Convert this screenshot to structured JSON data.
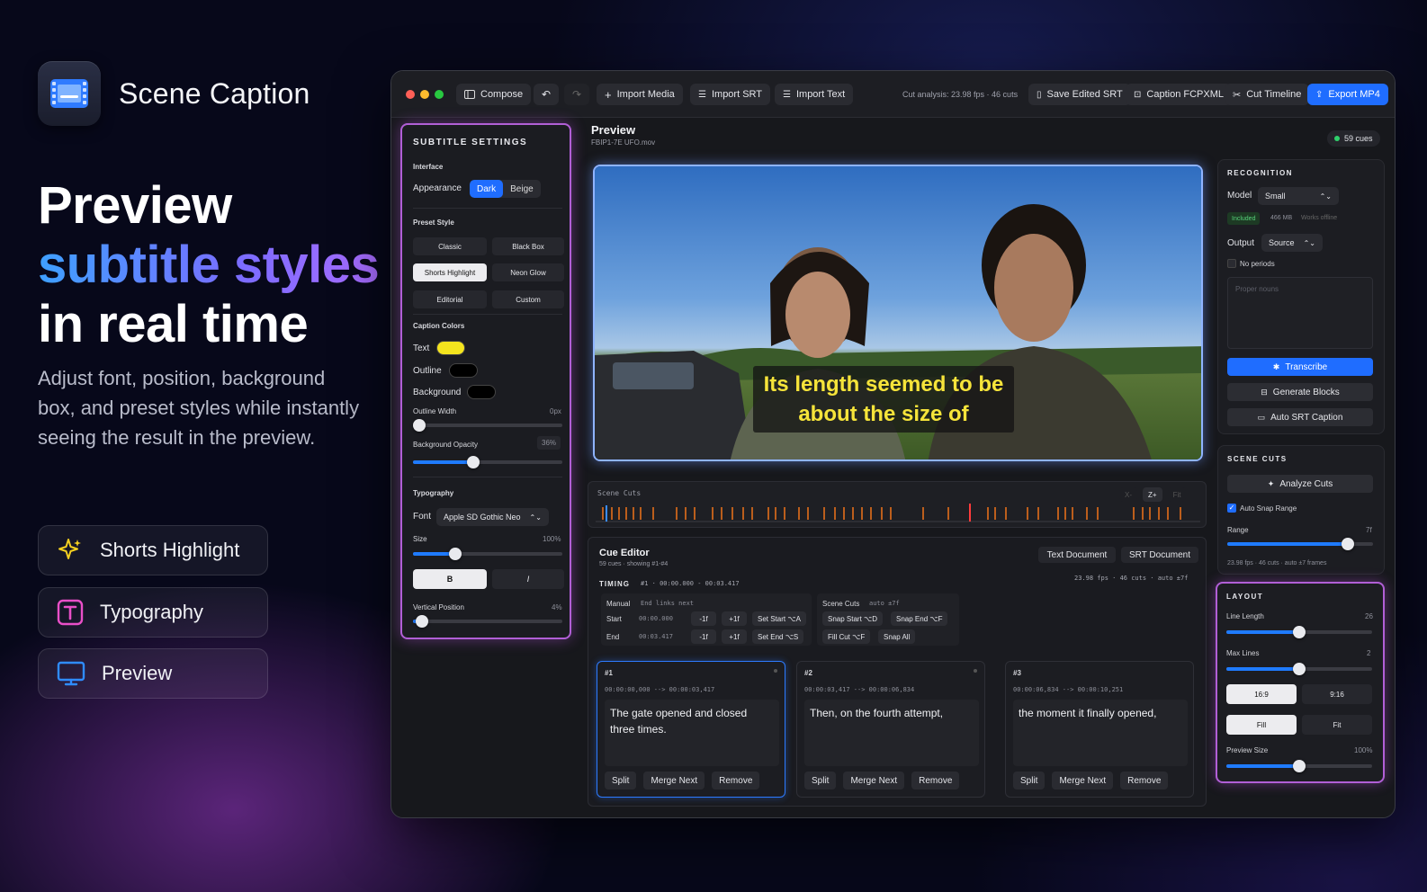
{
  "brand": {
    "name": "Scene Caption"
  },
  "headline": {
    "line1": "Preview",
    "line2": "subtitle styles",
    "line3": "in real time"
  },
  "subtitle": "Adjust font, position, background box, and preset styles while instantly seeing the result in the preview.",
  "features": [
    {
      "icon": "sparkle-icon",
      "label": "Shorts Highlight"
    },
    {
      "icon": "text-t-icon",
      "label": "Typography"
    },
    {
      "icon": "monitor-icon",
      "label": "Preview"
    }
  ],
  "toolbar": {
    "compose": "Compose",
    "import_media": "Import Media",
    "import_srt": "Import SRT",
    "import_text": "Import Text",
    "cut_analysis": "Cut analysis: 23.98 fps · 46 cuts",
    "save_srt": "Save Edited SRT",
    "caption_fcpxml": "Caption FCPXML",
    "cut_timeline": "Cut Timeline",
    "export_mp4": "Export MP4"
  },
  "settings": {
    "title": "SUBTITLE SETTINGS",
    "interface": "Interface",
    "appearance_label": "Appearance",
    "appearance_options": [
      "Dark",
      "Beige"
    ],
    "appearance_selected": "Dark",
    "preset_style": "Preset Style",
    "presets": [
      "Classic",
      "Black Box",
      "Shorts Highlight",
      "Neon Glow",
      "Editorial",
      "Custom"
    ],
    "preset_selected": "Shorts Highlight",
    "caption_colors": "Caption Colors",
    "text_label": "Text",
    "outline_label": "Outline",
    "background_label": "Background",
    "outline_width_label": "Outline Width",
    "outline_width_value": "0px",
    "bg_opacity_label": "Background Opacity",
    "bg_opacity_value": "36%",
    "bg_opacity_level": 0.36,
    "typography": "Typography",
    "font_label": "Font",
    "font_value": "Apple SD Gothic Neo",
    "size_label": "Size",
    "size_value": "100%",
    "bold": "B",
    "italic": "I",
    "vpos_label": "Vertical Position",
    "vpos_value": "4%",
    "colors": {
      "text": "#f4e41e",
      "outline": "#000000",
      "background": "#000000"
    }
  },
  "preview": {
    "title": "Preview",
    "file": "FBIP1-7E UFO.mov",
    "cues_badge": "59 cues",
    "caption_line1": "Its length seemed to be",
    "caption_line2": "about the size of"
  },
  "scene_cuts": {
    "label": "Scene Cuts",
    "controls": [
      "X-",
      "Z+",
      "Fit"
    ]
  },
  "cue_editor": {
    "title": "Cue Editor",
    "meta": "59 cues · showing #1-#4",
    "text_doc": "Text Document",
    "srt_doc": "SRT Document",
    "timing_label": "TIMING",
    "timing_range": "#1 · 00:00.000 - 00:03.417",
    "stats": "23.98 fps · 46 cuts · auto ±7f",
    "manual": "Manual",
    "manual_hint": "End links next",
    "start_label": "Start",
    "start_value": "00:00.000",
    "end_label": "End",
    "end_value": "00:03.417",
    "minus1f": "-1f",
    "plus1f": "+1f",
    "set_start": "Set Start ⌥A",
    "set_end": "Set End ⌥S",
    "scene_cuts_title": "Scene Cuts",
    "scene_cuts_hint": "auto ±7f",
    "snap_start": "Snap Start ⌥D",
    "snap_end": "Snap End ⌥F",
    "fill_cut": "Fill Cut ⌥F",
    "snap_all": "Snap All",
    "cues": [
      {
        "num": "#1",
        "time": "00:00:00,000 --> 00:00:03,417",
        "text": "The gate opened and closed three times."
      },
      {
        "num": "#2",
        "time": "00:00:03,417 --> 00:00:06,834",
        "text": "Then, on the fourth attempt,"
      },
      {
        "num": "#3",
        "time": "00:00:06,834 --> 00:00:10,251",
        "text": "the moment it finally opened,"
      }
    ],
    "actions": [
      "Split",
      "Merge Next",
      "Remove"
    ]
  },
  "recognition": {
    "title": "RECOGNITION",
    "model_label": "Model",
    "model_value": "Small",
    "included": "Included",
    "size": "466 MB",
    "offline": "Works offline",
    "output_label": "Output",
    "output_value": "Source",
    "no_periods": "No periods",
    "proper_nouns_placeholder": "Proper nouns",
    "transcribe": "Transcribe",
    "generate_blocks": "Generate Blocks",
    "auto_srt": "Auto SRT Caption"
  },
  "scene_cuts_panel": {
    "title": "SCENE CUTS",
    "analyze": "Analyze Cuts",
    "auto_snap": "Auto Snap Range",
    "range_label": "Range",
    "range_value": "7f",
    "footer": "23.98 fps · 46 cuts · auto ±7 frames"
  },
  "layout": {
    "title": "LAYOUT",
    "line_length_label": "Line Length",
    "line_length_value": "26",
    "max_lines_label": "Max Lines",
    "max_lines_value": "2",
    "ratios": [
      "16:9",
      "9:16"
    ],
    "fit_options": [
      "Fill",
      "Fit"
    ],
    "preview_size_label": "Preview Size",
    "preview_size_value": "100%"
  }
}
